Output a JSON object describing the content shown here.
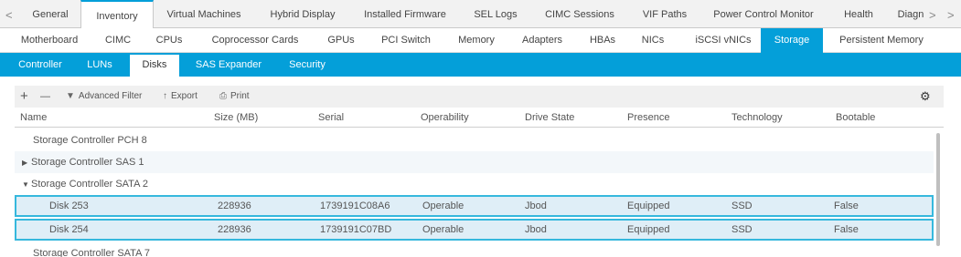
{
  "top_tabs": [
    "General",
    "Inventory",
    "Virtual Machines",
    "Hybrid Display",
    "Installed Firmware",
    "SEL Logs",
    "CIMC Sessions",
    "VIF Paths",
    "Power Control Monitor",
    "Health",
    "Diagn"
  ],
  "top_tabs_active": "Inventory",
  "nav": {
    "prev": "<",
    "next": ">"
  },
  "sub_tabs": [
    "Motherboard",
    "CIMC",
    "CPUs",
    "Coprocessor Cards",
    "GPUs",
    "PCI Switch",
    "Memory",
    "Adapters",
    "HBAs",
    "NICs",
    "iSCSI vNICs",
    "Storage",
    "Persistent Memory"
  ],
  "sub_tabs_active": "Storage",
  "storage_tabs": [
    "Controller",
    "LUNs",
    "Disks",
    "SAS Expander",
    "Security"
  ],
  "storage_tabs_active": "Disks",
  "toolbar": {
    "add": "+",
    "remove": "—",
    "advanced_filter": "Advanced Filter",
    "export": "Export",
    "print": "Print",
    "settings": "⚙"
  },
  "columns": [
    "Name",
    "Size (MB)",
    "Serial",
    "Operability",
    "Drive State",
    "Presence",
    "Technology",
    "Bootable"
  ],
  "groups": [
    {
      "name": "Storage Controller PCH 8",
      "expandable": false
    },
    {
      "name": "Storage Controller SAS 1",
      "expandable": true,
      "expanded": false
    },
    {
      "name": "Storage Controller SATA 2",
      "expandable": true,
      "expanded": true
    }
  ],
  "disks": [
    {
      "name": "Disk 253",
      "size": "228936",
      "serial": "1739191C08A6",
      "operability": "Operable",
      "drive_state": "Jbod",
      "presence": "Equipped",
      "technology": "SSD",
      "bootable": "False"
    },
    {
      "name": "Disk 254",
      "size": "228936",
      "serial": "1739191C07BD",
      "operability": "Operable",
      "drive_state": "Jbod",
      "presence": "Equipped",
      "technology": "SSD",
      "bootable": "False"
    }
  ],
  "partial_row": "Storage Controller SATA 7",
  "colors": {
    "accent": "#049fd9",
    "selection_border": "#36b8dd"
  }
}
